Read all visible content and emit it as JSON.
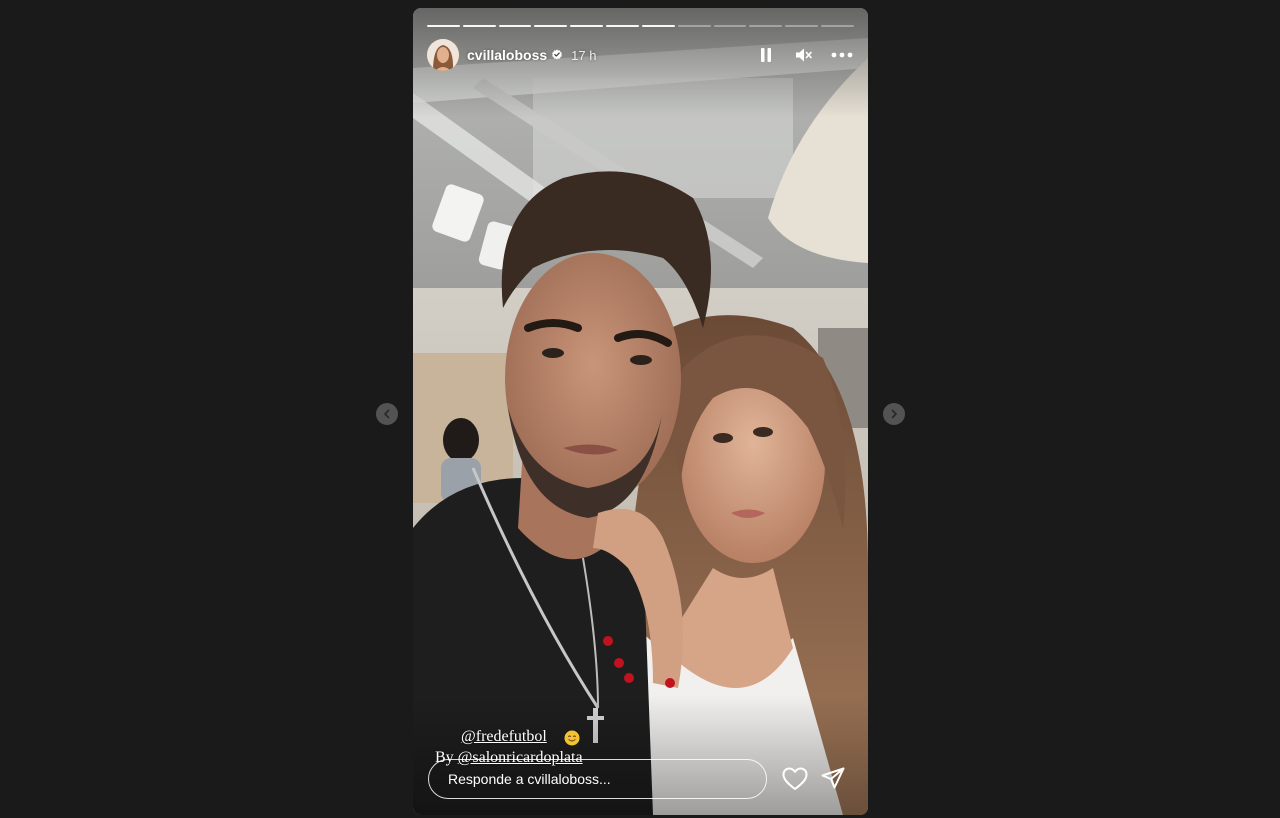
{
  "story": {
    "username": "cvillaloboss",
    "time_ago": "17 h",
    "verified": true,
    "progress_total": 12,
    "progress_done": 7,
    "caption": {
      "mention1": "@fredefutbol",
      "emoji_icon": "smiling-face-emoji-icon",
      "by_prefix": "By ",
      "mention2": "@salonricardoplata"
    },
    "reply_placeholder": "Responde a cvillaloboss..."
  },
  "icons": {
    "pause": "pause-icon",
    "mute": "speaker-muted-icon",
    "more": "more-options-icon",
    "like": "heart-icon",
    "share": "paper-plane-icon",
    "prev": "chevron-left-icon",
    "next": "chevron-right-icon"
  },
  "colors": {
    "page_background": "#1a1a1a",
    "verified_badge": "#ffffff",
    "text": "#ffffff"
  }
}
